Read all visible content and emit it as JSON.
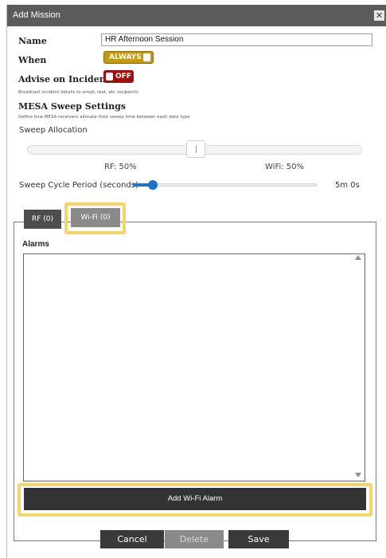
{
  "window": {
    "title": "Add Mission",
    "close_symbol": "✕"
  },
  "form": {
    "name_label": "Name",
    "name_value": "HR Afternoon Session",
    "when_label": "When",
    "when_toggle": "ALWAYS",
    "advise_label": "Advise on Incidents",
    "advise_toggle": "OFF",
    "advise_note": "Broadcast incident details to email, text, etc recipients"
  },
  "sweep": {
    "title": "MESA Sweep Settings",
    "note": "Define how MESA receivers allocate their sweep time between each data type",
    "allocation_label": "Sweep Allocation",
    "allocation_rf_fraction": 0.5,
    "rf_label": "RF: 50%",
    "wifi_label": "WiFi: 50%",
    "cycle_label": "Sweep Cycle Period (seconds)",
    "cycle_value": "5m 0s"
  },
  "tabs": [
    {
      "label": "RF (0)",
      "selected": false
    },
    {
      "label": "Wi-Fi (0)",
      "selected": true
    }
  ],
  "panel": {
    "alarms_label": "Alarms",
    "add_button": "Add Wi-Fi Alarm"
  },
  "footer": {
    "cancel": "Cancel",
    "delete": "Delete",
    "save": "Save"
  },
  "colors": {
    "titlebar": "#5b5b5b",
    "always_toggle": "#c59a0f",
    "off_toggle": "#a40e0e",
    "slider_accent": "#1d72c9",
    "highlight": "#f7d46a"
  }
}
